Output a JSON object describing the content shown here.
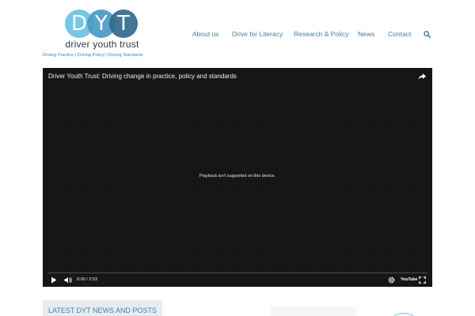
{
  "header": {
    "logo_letters": [
      "D",
      "Y",
      "T"
    ],
    "brand_name": "driver youth trust",
    "tagline": "Driving Practice  |  Driving Policy  |  Driving Standards",
    "nav": [
      {
        "label": "About us"
      },
      {
        "label": "Drive for Literacy"
      },
      {
        "label": "Research & Policy"
      },
      {
        "label": "News"
      },
      {
        "label": "Contact"
      }
    ],
    "search_icon": "magnifier"
  },
  "video": {
    "title": "Driver Youth Trust: Driving change in practice, policy and standards",
    "message": "Playback isn't supported on this device.",
    "time": "0:00 / 2:53",
    "youtube_label": "YouTube",
    "icons": [
      "share-icon",
      "play-icon",
      "volume-icon",
      "settings-icon",
      "fullscreen-icon"
    ]
  },
  "news": {
    "heading": "LATEST DYT NEWS AND POSTS"
  },
  "colors": {
    "accent": "#3d86b3",
    "nav": "#4a7d9e",
    "logo_light": "#6cc2e4",
    "logo_mid": "#4a9ac4",
    "logo_dark": "#2f6c8d",
    "video_bg": "#141414"
  }
}
